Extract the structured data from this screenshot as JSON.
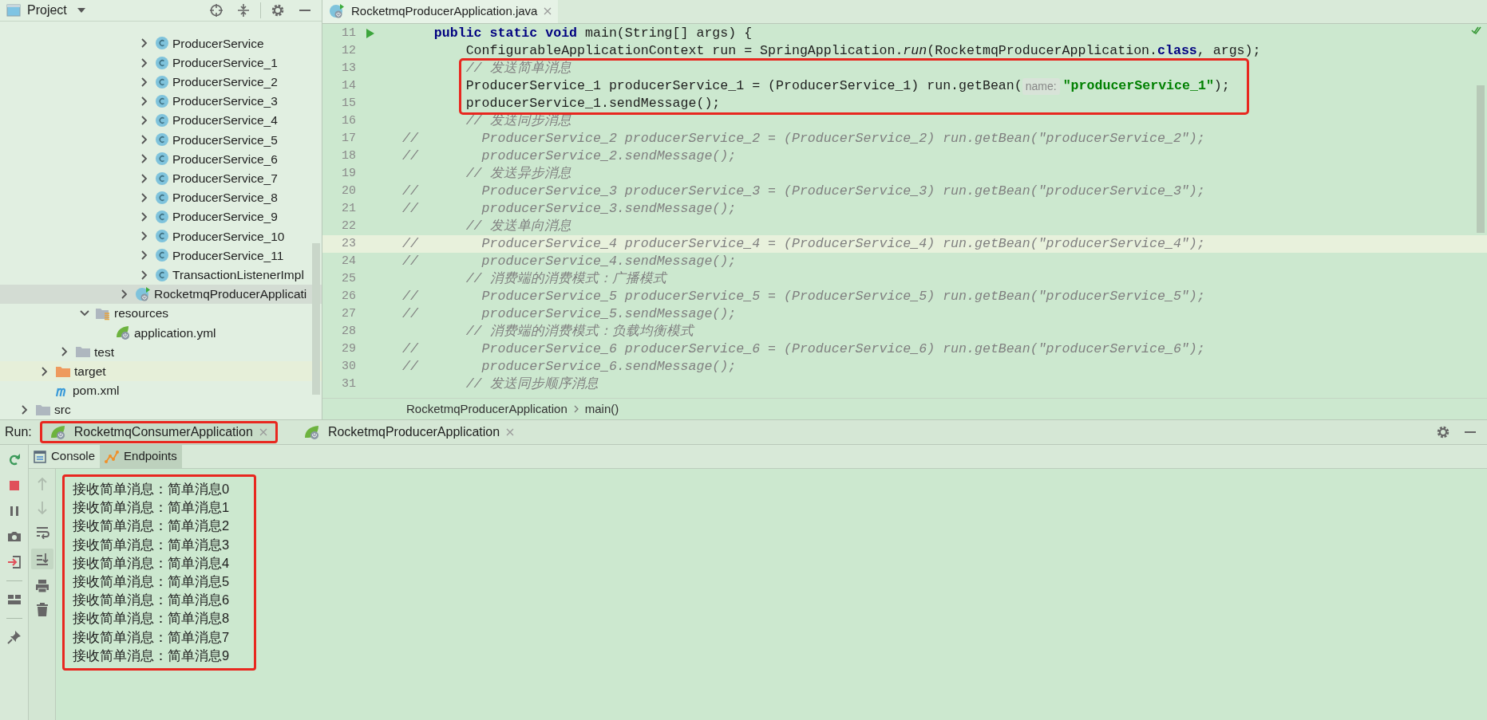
{
  "project_panel": {
    "title": "Project",
    "tree": [
      {
        "children": [
          {
            "children": [
              {
                "children": [
                  {
                    "children": [
                      {
                        "children": [
                          {
                            "children": [
                              {
                                "label": "ProducerService",
                                "kind": "class",
                                "expanded": false,
                                "selected": false
                              },
                              {
                                "label": "ProducerService_1",
                                "kind": "class",
                                "expanded": false,
                                "selected": false
                              },
                              {
                                "label": "ProducerService_2",
                                "kind": "class",
                                "expanded": false,
                                "selected": false
                              },
                              {
                                "label": "ProducerService_3",
                                "kind": "class",
                                "expanded": false,
                                "selected": false
                              },
                              {
                                "label": "ProducerService_4",
                                "kind": "class",
                                "expanded": false,
                                "selected": false
                              },
                              {
                                "label": "ProducerService_5",
                                "kind": "class",
                                "expanded": false,
                                "selected": false
                              },
                              {
                                "label": "ProducerService_6",
                                "kind": "class",
                                "expanded": false,
                                "selected": false
                              },
                              {
                                "label": "ProducerService_7",
                                "kind": "class",
                                "expanded": false,
                                "selected": false
                              },
                              {
                                "label": "ProducerService_8",
                                "kind": "class",
                                "expanded": false,
                                "selected": false
                              },
                              {
                                "label": "ProducerService_9",
                                "kind": "class",
                                "expanded": false,
                                "selected": false
                              },
                              {
                                "label": "ProducerService_10",
                                "kind": "class",
                                "expanded": false,
                                "selected": false
                              },
                              {
                                "label": "ProducerService_11",
                                "kind": "class",
                                "expanded": false,
                                "selected": false
                              },
                              {
                                "label": "TransactionListenerImpl",
                                "kind": "class",
                                "expanded": false,
                                "selected": false
                              }
                            ]
                          },
                          {
                            "label": "RocketmqProducerApplicati",
                            "kind": "spring_app",
                            "expanded": false,
                            "selected": true
                          }
                        ]
                      }
                    ]
                  },
                  {
                    "label": "resources",
                    "kind": "resources_folder",
                    "expanded": true,
                    "selected": false,
                    "children": [
                      {
                        "label": "application.yml",
                        "kind": "spring_config",
                        "selected": false
                      }
                    ]
                  }
                ]
              },
              {
                "label": "test",
                "kind": "folder",
                "expanded": false,
                "selected": false
              }
            ]
          },
          {
            "label": "target",
            "kind": "excluded_folder",
            "expanded": false,
            "selected": false
          },
          {
            "label": "pom.xml",
            "kind": "maven",
            "selected": false
          }
        ]
      },
      {
        "label": "src",
        "kind": "folder",
        "expanded": false,
        "selected": false
      }
    ]
  },
  "editor": {
    "tab": {
      "label": "RocketmqProducerApplication.java",
      "selected": true
    },
    "lines": [
      {
        "number": "11",
        "run": true,
        "segments": [
          {
            "text": "    public static void",
            "kind": "keyword"
          },
          {
            "text": " main(String[] args) {",
            "kind": "plain"
          }
        ]
      },
      {
        "number": "12",
        "segments": [
          {
            "text": "        ConfigurableApplicationContext run = SpringApplication.",
            "kind": "plain"
          },
          {
            "text": "run",
            "kind": "italic"
          },
          {
            "text": "(RocketmqProducerApplication.",
            "kind": "plain"
          },
          {
            "text": "class",
            "kind": "keyword"
          },
          {
            "text": ", args);",
            "kind": "plain"
          }
        ]
      },
      {
        "number": "13",
        "boxed": true,
        "segments": [
          {
            "text": "        // 发送简单消息",
            "kind": "comment"
          }
        ]
      },
      {
        "number": "14",
        "boxed": true,
        "segments": [
          {
            "text": "        ProducerService_1 producerService_1 = (ProducerService_1) run.getBean(",
            "kind": "plain"
          },
          {
            "text": "name:",
            "kind": "hint"
          },
          {
            "text": "\"producerService_1\"",
            "kind": "string"
          },
          {
            "text": ");",
            "kind": "plain"
          }
        ]
      },
      {
        "number": "15",
        "boxed": true,
        "segments": [
          {
            "text": "        producerService_1.sendMessage();",
            "kind": "plain"
          }
        ]
      },
      {
        "number": "16",
        "segments": [
          {
            "text": "        // 发送同步消息",
            "kind": "comment"
          }
        ]
      },
      {
        "number": "17",
        "segments": [
          {
            "text": "//        ProducerService_2 producerService_2 = (ProducerService_2) run.getBean(\"producerService_2\");",
            "kind": "comment"
          }
        ]
      },
      {
        "number": "18",
        "segments": [
          {
            "text": "//        producerService_2.sendMessage();",
            "kind": "comment"
          }
        ]
      },
      {
        "number": "19",
        "segments": [
          {
            "text": "        // 发送异步消息",
            "kind": "comment"
          }
        ]
      },
      {
        "number": "20",
        "segments": [
          {
            "text": "//        ProducerService_3 producerService_3 = (ProducerService_3) run.getBean(\"producerService_3\");",
            "kind": "comment"
          }
        ]
      },
      {
        "number": "21",
        "segments": [
          {
            "text": "//        producerService_3.sendMessage();",
            "kind": "comment"
          }
        ]
      },
      {
        "number": "22",
        "segments": [
          {
            "text": "        // 发送单向消息",
            "kind": "comment"
          }
        ]
      },
      {
        "number": "23",
        "current": true,
        "segments": [
          {
            "text": "//        ProducerService_4 producerService_4 = (ProducerService_4) run.getBean(\"producerService_4\");",
            "kind": "comment"
          }
        ]
      },
      {
        "number": "24",
        "segments": [
          {
            "text": "//        producerService_4.sendMessage();",
            "kind": "comment"
          }
        ]
      },
      {
        "number": "25",
        "segments": [
          {
            "text": "        // 消费端的消费模式：广播模式",
            "kind": "comment"
          }
        ]
      },
      {
        "number": "26",
        "segments": [
          {
            "text": "//        ProducerService_5 producerService_5 = (ProducerService_5) run.getBean(\"producerService_5\");",
            "kind": "comment"
          }
        ]
      },
      {
        "number": "27",
        "segments": [
          {
            "text": "//        producerService_5.sendMessage();",
            "kind": "comment"
          }
        ]
      },
      {
        "number": "28",
        "segments": [
          {
            "text": "        // 消费端的消费模式：负载均衡模式",
            "kind": "comment"
          }
        ]
      },
      {
        "number": "29",
        "segments": [
          {
            "text": "//        ProducerService_6 producerService_6 = (ProducerService_6) run.getBean(\"producerService_6\");",
            "kind": "comment"
          }
        ]
      },
      {
        "number": "30",
        "segments": [
          {
            "text": "//        producerService_6.sendMessage();",
            "kind": "comment"
          }
        ]
      },
      {
        "number": "31",
        "segments": [
          {
            "text": "        // 发送同步顺序消息",
            "kind": "comment"
          }
        ]
      }
    ],
    "breadcrumbs": [
      "RocketmqProducerApplication",
      "main()"
    ]
  },
  "run_panel": {
    "label": "Run:",
    "tabs": [
      {
        "label": "RocketmqConsumerApplication",
        "selected": true,
        "boxed": true
      },
      {
        "label": "RocketmqProducerApplication",
        "selected": false,
        "boxed": false
      }
    ],
    "console_tabs": [
      {
        "label": "Console",
        "kind": "console",
        "highlighted": false
      },
      {
        "label": "Endpoints",
        "kind": "endpoints",
        "highlighted": true
      }
    ],
    "console_boxed": true,
    "output": [
      "接收简单消息：简单消息0",
      "接收简单消息：简单消息1",
      "接收简单消息：简单消息2",
      "接收简单消息：简单消息3",
      "接收简单消息：简单消息4",
      "接收简单消息：简单消息5",
      "接收简单消息：简单消息6",
      "接收简单消息：简单消息8",
      "接收简单消息：简单消息7",
      "接收简单消息：简单消息9"
    ]
  }
}
